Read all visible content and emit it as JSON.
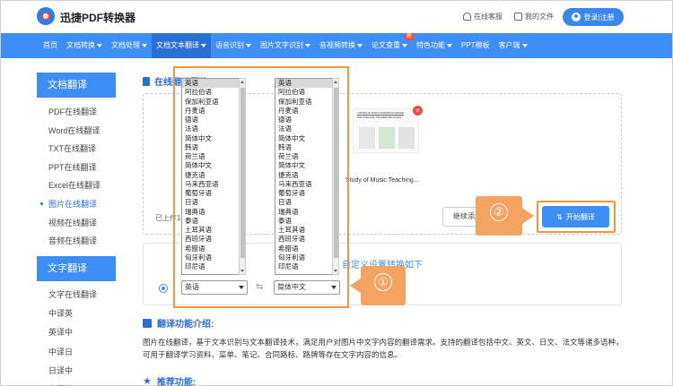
{
  "header": {
    "logo_text": "迅捷PDF转换器",
    "service_label": "在线客服",
    "files_label": "我的文件",
    "login_label": "登录|注册"
  },
  "nav": {
    "items": [
      {
        "label": "首页",
        "dropdown": false
      },
      {
        "label": "文档转换",
        "dropdown": true
      },
      {
        "label": "文档处理",
        "dropdown": true
      },
      {
        "label": "文档文本翻译",
        "dropdown": true,
        "active": true
      },
      {
        "label": "语音识别",
        "dropdown": true
      },
      {
        "label": "图片文字识别",
        "dropdown": true
      },
      {
        "label": "音视频转换",
        "dropdown": true
      },
      {
        "label": "论文查重",
        "dropdown": true,
        "badge": "新"
      },
      {
        "label": "特色功能",
        "dropdown": true
      },
      {
        "label": "PPT模板",
        "dropdown": false
      },
      {
        "label": "客户端",
        "dropdown": true
      }
    ]
  },
  "sidebar": {
    "group1_title": "文档翻译",
    "group1_items": [
      "PDF在线翻译",
      "Word在线翻译",
      "TXT在线翻译",
      "PPT在线翻译",
      "Excel在线翻译",
      "图片在线翻译",
      "视频在线翻译",
      "音频在线翻译"
    ],
    "active_index": 5,
    "group2_title": "文字翻译",
    "group2_items": [
      "文字在线翻译",
      "中译英",
      "英译中",
      "中译日",
      "日译中",
      "中译韩"
    ]
  },
  "main": {
    "section_title": "在线翻译图片",
    "thumb_caption": "Study of Music Teaching...",
    "thumb_heading_1": "CURTAIN OF MUSIC CHARISMATIC REVIEW",
    "thumb_heading_2": "AND STIMULATE THE EXERCISE OF MUS",
    "uploaded_text": "已上传1",
    "continue_label": "继续添加",
    "start_label": "开始翻译",
    "settings_text": "自定义设置转换如下",
    "source_lang": "英语",
    "target_lang": "简体中文",
    "intro_title": "翻译功能介绍:",
    "intro_text": "图片在线翻译，基于文本识别与文本翻译技术，满足用户对图片中文字内容的翻译需求。支持的翻译包括中文、英文、日文、法文等诸多语种，可用于翻译学习资料、菜单、笔记、合同路标、路牌等存在文字内容的信息。",
    "rec_title": "推荐功能:"
  },
  "dropdown_source": {
    "options": [
      "英语",
      "阿拉伯语",
      "保加利亚语",
      "丹麦语",
      "德语",
      "法语",
      "简体中文",
      "韩语",
      "荷兰语",
      "简体中文",
      "捷克语",
      "马来西亚语",
      "葡萄牙语",
      "日语",
      "瑞典语",
      "泰语",
      "土耳其语",
      "西班牙语",
      "希腊语",
      "匈牙利语",
      "印尼语"
    ],
    "selected": "英语"
  },
  "dropdown_target": {
    "options": [
      "英语",
      "阿拉伯语",
      "保加利亚语",
      "丹麦语",
      "德语",
      "法语",
      "简体中文",
      "韩语",
      "荷兰语",
      "简体中文",
      "捷克语",
      "马来西亚语",
      "葡萄牙语",
      "日语",
      "瑞典语",
      "泰语",
      "土耳其语",
      "西班牙语",
      "希腊语",
      "匈牙利语",
      "印尼语"
    ],
    "selected": "英语"
  },
  "callouts": {
    "one": "①",
    "two": "②"
  },
  "colors": {
    "brand": "#3e8ef7",
    "callout": "#f4a460",
    "highlight": "#f0963c"
  }
}
